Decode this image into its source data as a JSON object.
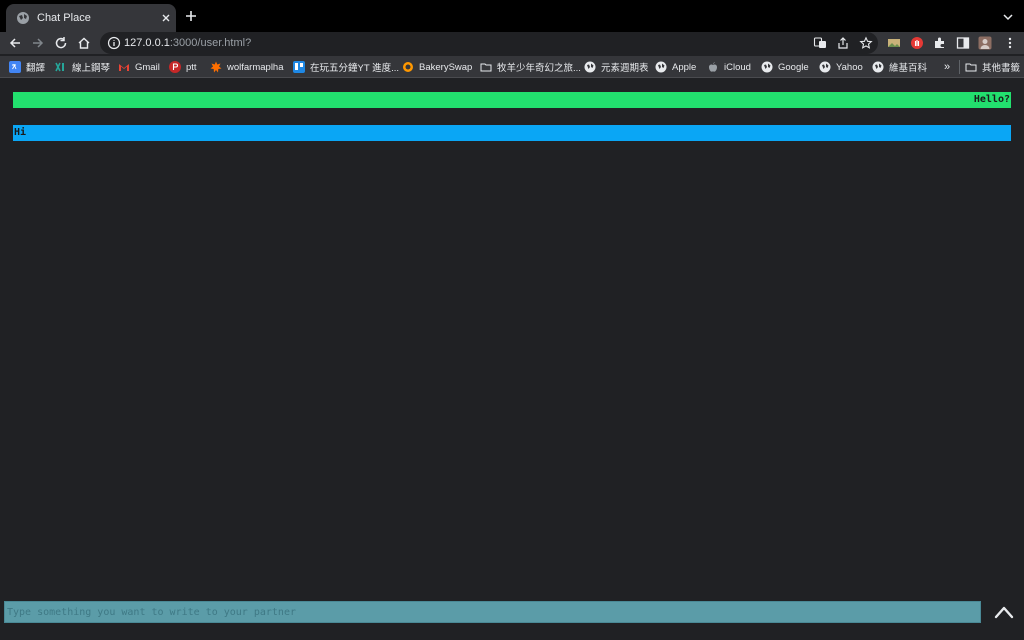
{
  "browser": {
    "tab_title": "Chat Place",
    "url_host": "127.0.0.1",
    "url_rest": ":3000/user.html?",
    "bookmarks": [
      {
        "label": "翻譯",
        "icon": "translate-icon",
        "color": "#4285f4"
      },
      {
        "label": "線上鋼琴",
        "icon": "piano-icon",
        "color": "#26a69a"
      },
      {
        "label": "Gmail",
        "icon": "gmail-icon",
        "color": "#ea4335"
      },
      {
        "label": "ptt",
        "icon": "ptt-icon",
        "color": "#d32f2f"
      },
      {
        "label": "wolfarmaplha",
        "icon": "wolfram-icon",
        "color": "#ff6f00"
      },
      {
        "label": "在玩五分鐘YT 進度...",
        "icon": "trello-icon",
        "color": "#1e88e5"
      },
      {
        "label": "BakerySwap",
        "icon": "bakeryswap-icon",
        "color": "#ff9800"
      },
      {
        "label": "牧羊少年奇幻之旅...",
        "icon": "folder-icon",
        "color": "#e8eaed"
      },
      {
        "label": "元素週期表",
        "icon": "globe-icon",
        "color": "#e8eaed"
      },
      {
        "label": "Apple",
        "icon": "globe-icon",
        "color": "#e8eaed"
      },
      {
        "label": "iCloud",
        "icon": "apple-icon",
        "color": "#9aa0a6"
      },
      {
        "label": "Google",
        "icon": "globe-icon",
        "color": "#e8eaed"
      },
      {
        "label": "Yahoo",
        "icon": "globe-icon",
        "color": "#e8eaed"
      },
      {
        "label": "維基百科",
        "icon": "globe-icon",
        "color": "#e8eaed"
      }
    ],
    "overflow_label": "»",
    "other_bookmarks": "其他書籤"
  },
  "chat": {
    "messages": [
      {
        "sender": "partner",
        "text": "Hello?",
        "color": "#22e06e"
      },
      {
        "sender": "me",
        "text": "Hi",
        "color": "#0aa6f5"
      }
    ],
    "input_placeholder": "Type something you want to write to your partner",
    "input_value": ""
  }
}
